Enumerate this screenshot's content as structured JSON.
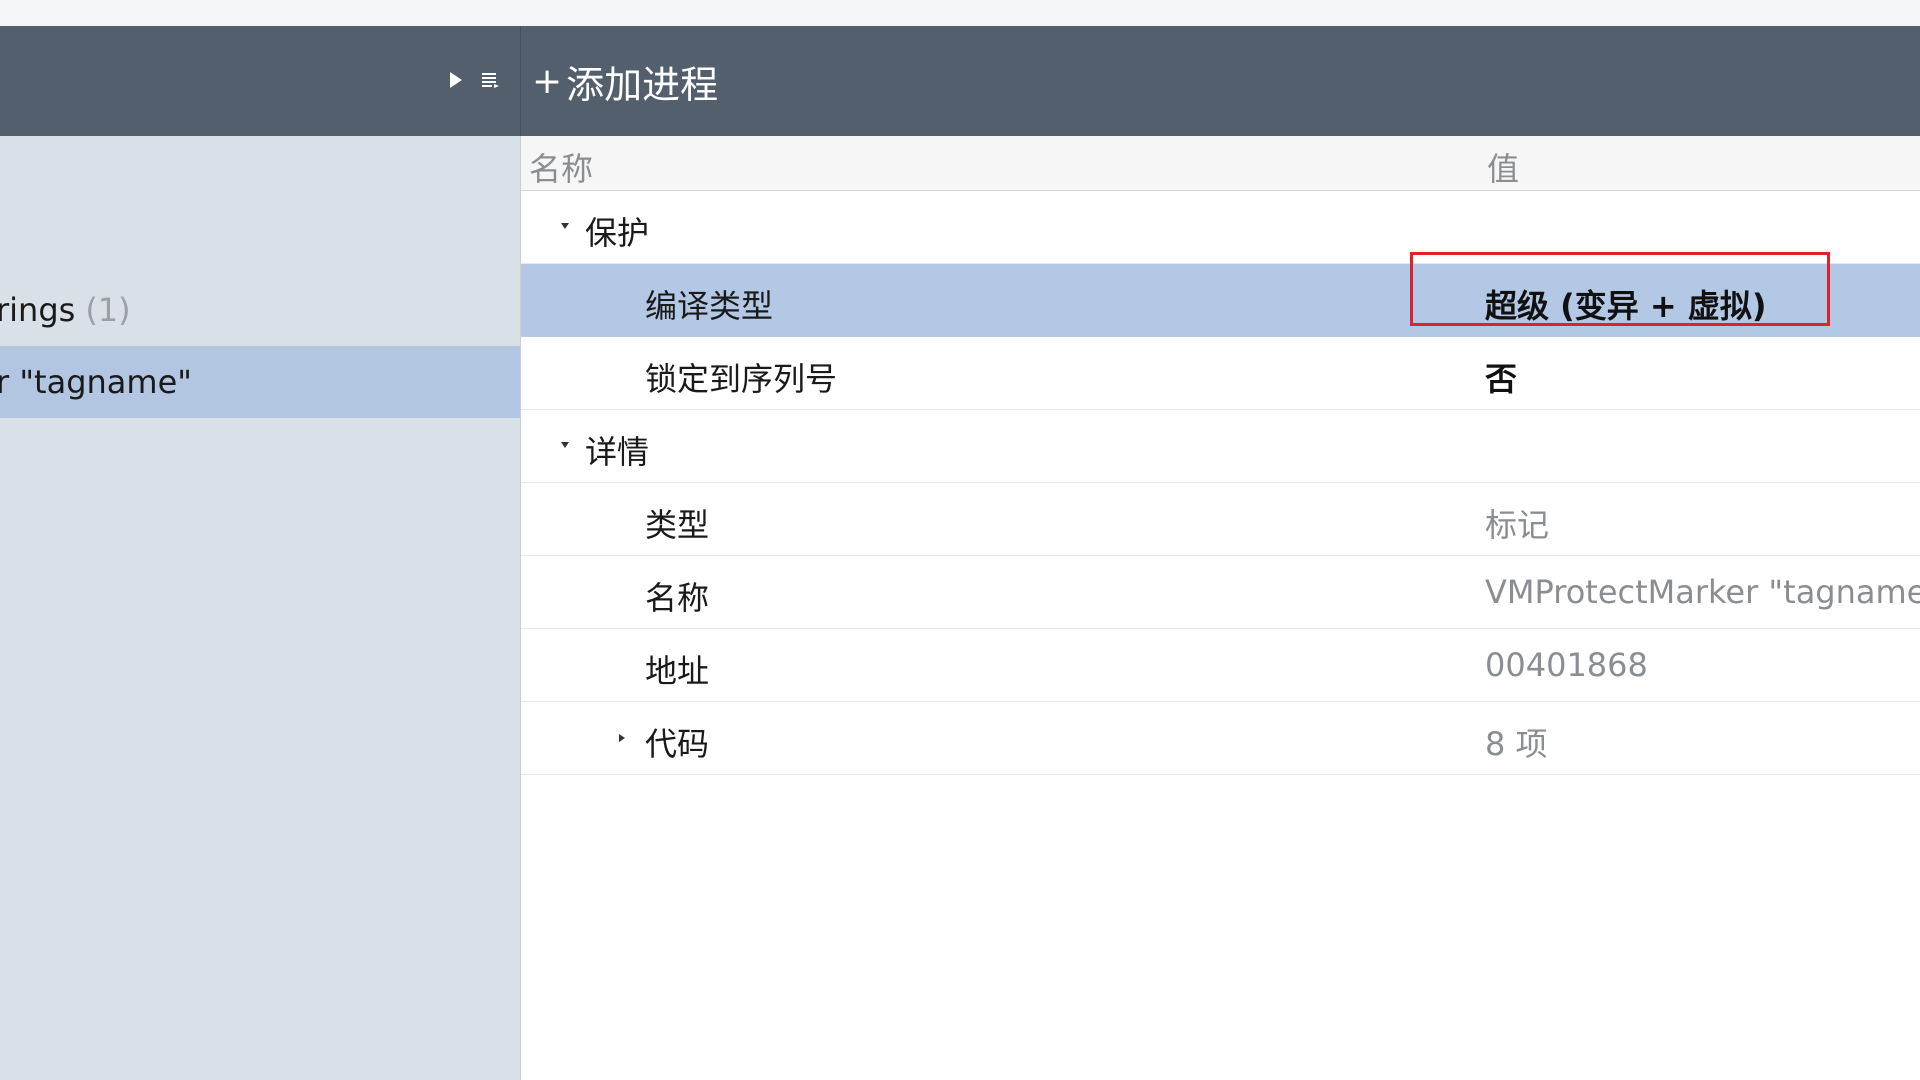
{
  "toolbar": {
    "add_process_plus": "+",
    "add_process_label": "添加进程"
  },
  "sidebar": {
    "items": [
      {
        "label": "rings",
        "count": "(1)"
      },
      {
        "label": "r \"tagname\""
      }
    ]
  },
  "table": {
    "header": {
      "name": "名称",
      "value": "值"
    },
    "rows": [
      {
        "name": "保护",
        "value": ""
      },
      {
        "name": "编译类型",
        "value": "超级 (变异 + 虚拟)"
      },
      {
        "name": "锁定到序列号",
        "value": "否"
      },
      {
        "name": "详情",
        "value": ""
      },
      {
        "name": "类型",
        "value": "标记"
      },
      {
        "name": "名称",
        "value": "VMProtectMarker \"tagname\""
      },
      {
        "name": "地址",
        "value": "00401868"
      },
      {
        "name": "代码",
        "value": "8 项"
      }
    ]
  },
  "colors": {
    "toolbar": "#535f6c",
    "sidebar": "#d9e0e8",
    "selection": "#b3c8e4",
    "highlight": "#e0202d"
  }
}
